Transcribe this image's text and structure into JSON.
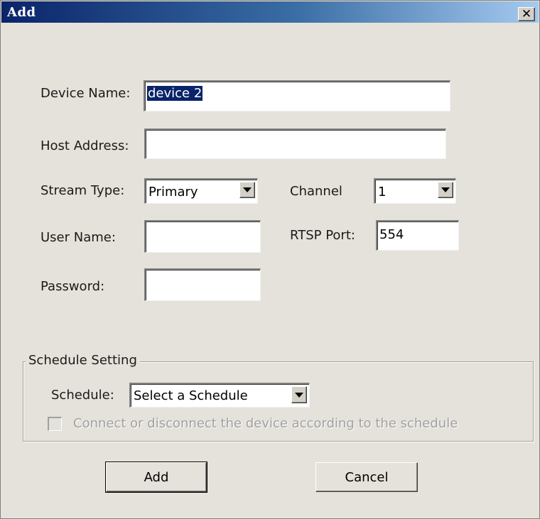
{
  "window": {
    "title": "Add",
    "close_glyph": "✕",
    "close_icon": "close-icon"
  },
  "form": {
    "device_name_label": "Device Name:",
    "device_name_value": "device 2",
    "host_address_label": "Host Address:",
    "host_address_value": "",
    "stream_type_label": "Stream Type:",
    "stream_type_value": "Primary",
    "channel_label": "Channel",
    "channel_value": "1",
    "user_name_label": "User Name:",
    "user_name_value": "",
    "rtsp_port_label": "RTSP Port:",
    "rtsp_port_value": "554",
    "password_label": "Password:",
    "password_value": ""
  },
  "schedule": {
    "group_title": "Schedule Setting",
    "schedule_label": "Schedule:",
    "schedule_value": "Select a Schedule",
    "checkbox_label": "Connect or disconnect the device according to the schedule",
    "checkbox_checked": false,
    "checkbox_enabled": false
  },
  "buttons": {
    "add_label": "Add",
    "cancel_label": "Cancel"
  },
  "colors": {
    "title_gradient_start": "#0a246a",
    "title_gradient_end": "#a6caf0",
    "dialog_background": "#e4e2da",
    "selection_highlight": "#0a246a",
    "disabled_text": "#a0a0a0"
  }
}
